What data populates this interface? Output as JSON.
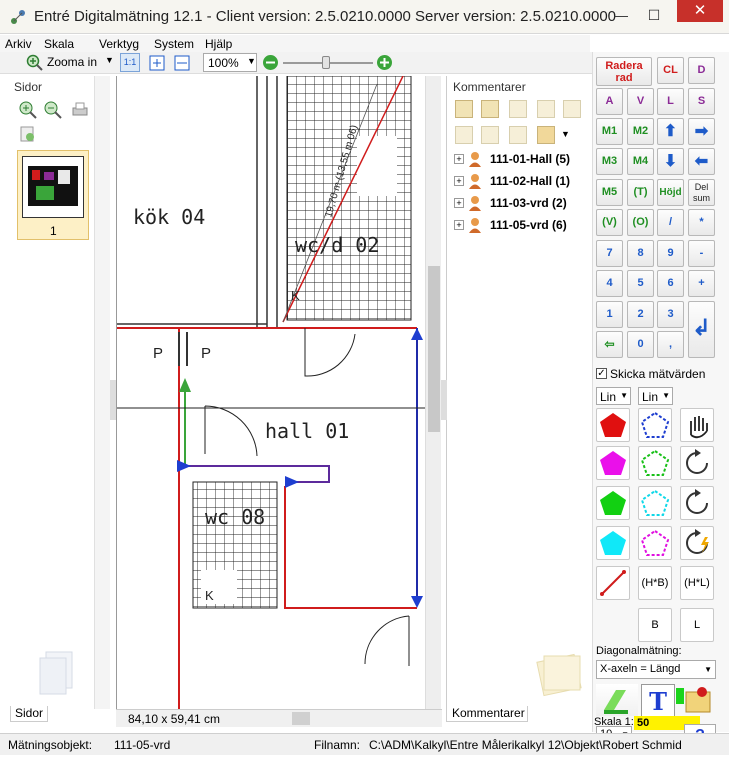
{
  "window": {
    "title": "Entré Digitalmätning 12.1 - Client version: 2.5.0210.0000 Server version: 2.5.0210.0000",
    "minimize": "—",
    "maximize": "☐",
    "close": "✕"
  },
  "menu": [
    "Arkiv",
    "Skala",
    "Verktyg",
    "System",
    "Hjälp"
  ],
  "toolbar": {
    "zoom_label": "Zooma in",
    "zoom_value": "100%"
  },
  "sidor": {
    "header": "Sidor",
    "page_number": "1",
    "tab": "Sidor"
  },
  "comments": {
    "header": "Kommentarer",
    "tab": "Kommentarer",
    "items": [
      {
        "label": "111-01-Hall (5)"
      },
      {
        "label": "111-02-Hall (1)"
      },
      {
        "label": "111-03-vrd (2)"
      },
      {
        "label": "111-05-vrd (6)"
      }
    ]
  },
  "drawing": {
    "labels": {
      "kitchen": "kök 04",
      "wc_d": "wc/d 02",
      "hall": "hall 01",
      "wc": "wc 08",
      "p1": "P",
      "p2": "P",
      "k1": "K",
      "k2": "K",
      "measure": "19,70 m (13,55 m 06)"
    },
    "size": "84,10 x 59,41 cm"
  },
  "keypad": {
    "radera": "Radera rad",
    "cl": "CL",
    "d": "D",
    "a": "A",
    "v": "V",
    "l": "L",
    "s": "S",
    "m1": "M1",
    "m2": "M2",
    "m3": "M3",
    "m4": "M4",
    "m5": "M5",
    "t": "(T)",
    "hojd": "Höjd",
    "delsum": "Del sum",
    "vv": "(V)",
    "oo": "(O)",
    "div": "/",
    "mul": "*",
    "n7": "7",
    "n8": "8",
    "n9": "9",
    "minus": "-",
    "n4": "4",
    "n5": "5",
    "n6": "6",
    "plus": "+",
    "n1": "1",
    "n2": "2",
    "n3": "3",
    "n0": "0",
    "comma": ","
  },
  "options": {
    "skicka": "Skicka mätvärden",
    "lin1": "Lin",
    "lin2": "Lin",
    "hb": "(H*B)",
    "hl": "(H*L)",
    "b": "B",
    "l": "L",
    "diagonal_label": "Diagonalmätning:",
    "diagonal_value": "X-axeln = Längd",
    "skala_label": "Skala 1:",
    "skala_value": "50",
    "scale_select": "10",
    "help": "?"
  },
  "status": {
    "matningsobjekt_label": "Mätningsobjekt:",
    "matningsobjekt_value": "111-05-vrd",
    "filnamn_label": "Filnamn:",
    "filnamn_value": "C:\\ADM\\Kalkyl\\Entre Målerikalkyl 12\\Objekt\\Robert Schmid"
  },
  "colors": {
    "accent_blue": "#1e5bc9",
    "red": "#d01c1c",
    "purple": "#8b2b96",
    "green": "#1f8f22"
  }
}
